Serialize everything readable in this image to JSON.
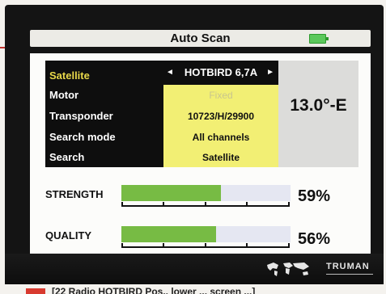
{
  "header": {
    "title": "Auto Scan",
    "battery_icon": "battery-icon"
  },
  "fields": [
    {
      "label": "Satellite",
      "value": "HOTBIRD 6,7A",
      "left_arrow": "◄",
      "right_arrow": "►"
    },
    {
      "label": "Motor",
      "value": "Fixed"
    },
    {
      "label": "Transponder",
      "value": "10723/H/29900"
    },
    {
      "label": "Search mode",
      "value": "All channels"
    },
    {
      "label": "Search",
      "value": "Satellite"
    }
  ],
  "position_readout": "13.0°-E",
  "meters": [
    {
      "label": "STRENGTH",
      "value": "59%",
      "fraction": 0.59
    },
    {
      "label": "QUALITY",
      "value": "56%",
      "fraction": 0.56
    }
  ],
  "footer": {
    "brand": "TRUMAN",
    "map_icon": "world-map-icon",
    "caption": "[22 Radio HOTBIRD Pos..  lower ... screen ...]"
  },
  "colors": {
    "accent_yellow": "#f2ef74",
    "bar_green": "#77bb44",
    "bar_track": "#e5e7f2",
    "battery_green": "#5cc85c"
  }
}
